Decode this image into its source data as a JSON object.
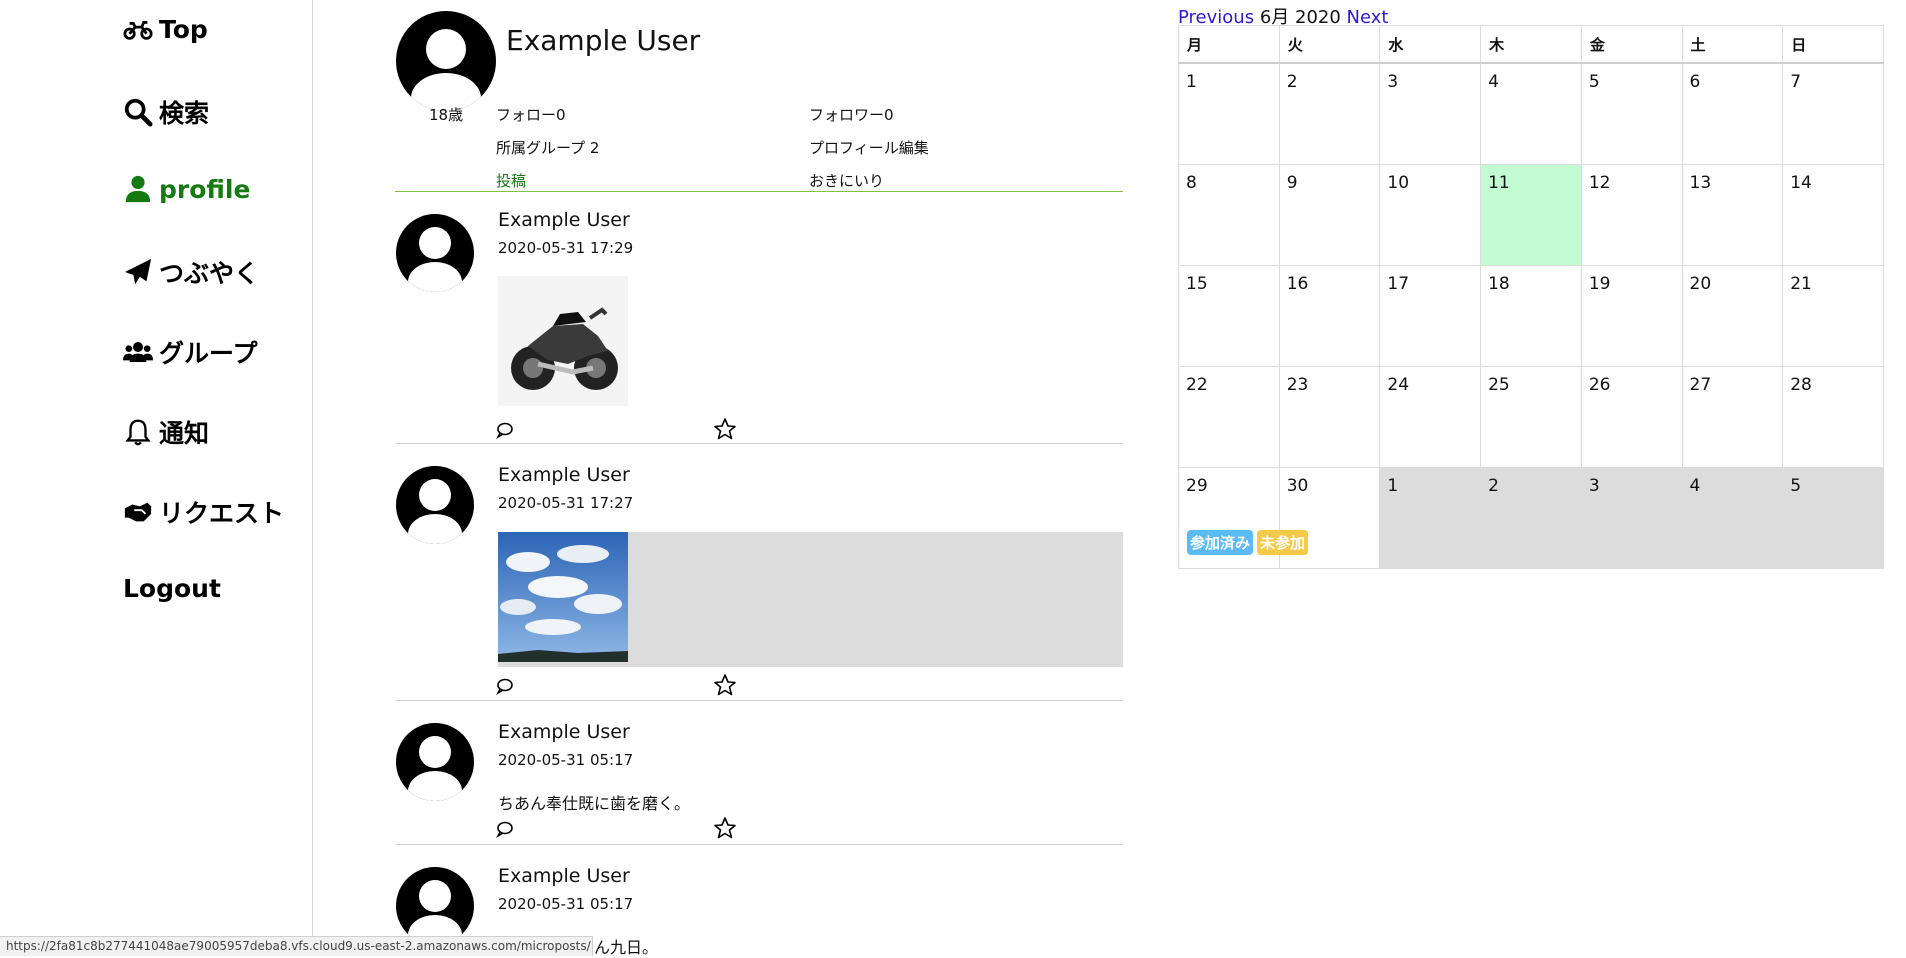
{
  "sidebar": {
    "items": [
      {
        "label": "Top",
        "icon": "motorcycle-icon"
      },
      {
        "label": "検索",
        "icon": "search-icon"
      },
      {
        "label": "profile",
        "icon": "user-icon"
      },
      {
        "label": "つぶやく",
        "icon": "paper-plane-icon"
      },
      {
        "label": "グループ",
        "icon": "users-icon"
      },
      {
        "label": "通知",
        "icon": "bell-icon"
      },
      {
        "label": "リクエスト",
        "icon": "handshake-icon"
      },
      {
        "label": "Logout",
        "icon": ""
      }
    ],
    "active_color": "#157a12"
  },
  "profile": {
    "name": "Example User",
    "age": "18歳",
    "following": "フォロー0",
    "followers": "フォロワー0",
    "groups": "所属グループ 2",
    "edit_link": "プロフィール編集",
    "tab_posts": "投稿",
    "tab_favorites": "おきにいり"
  },
  "posts": [
    {
      "user": "Example User",
      "time": "2020-05-31 17:29",
      "image": "motorcycle-photo",
      "text": ""
    },
    {
      "user": "Example User",
      "time": "2020-05-31 17:27",
      "image": "sky-photo",
      "text": ""
    },
    {
      "user": "Example User",
      "time": "2020-05-31 05:17",
      "image": "",
      "text": "ちあん奉仕既に歯を磨く。"
    },
    {
      "user": "Example User",
      "time": "2020-05-31 05:17",
      "image": "",
      "text": "色々消すちはん九日。"
    }
  ],
  "calendar": {
    "prev": "Previous",
    "month": "6月 2020",
    "next": "Next",
    "weekdays": [
      "月",
      "火",
      "水",
      "木",
      "金",
      "土",
      "日"
    ],
    "weeks": [
      [
        "1",
        "2",
        "3",
        "4",
        "5",
        "6",
        "7"
      ],
      [
        "8",
        "9",
        "10",
        "11",
        "12",
        "13",
        "14"
      ],
      [
        "15",
        "16",
        "17",
        "18",
        "19",
        "20",
        "21"
      ],
      [
        "22",
        "23",
        "24",
        "25",
        "26",
        "27",
        "28"
      ],
      [
        "29",
        "30",
        "1",
        "2",
        "3",
        "4",
        "5"
      ]
    ],
    "today": "11",
    "legend": [
      {
        "label": "参加済み",
        "color": "#5bbbf5"
      },
      {
        "label": "未参加",
        "color": "#f7c948"
      }
    ]
  },
  "status_url": "https://2fa81c8b277441048ae79005957deba8.vfs.cloud9.us-east-2.amazonaws.com/microposts/153"
}
